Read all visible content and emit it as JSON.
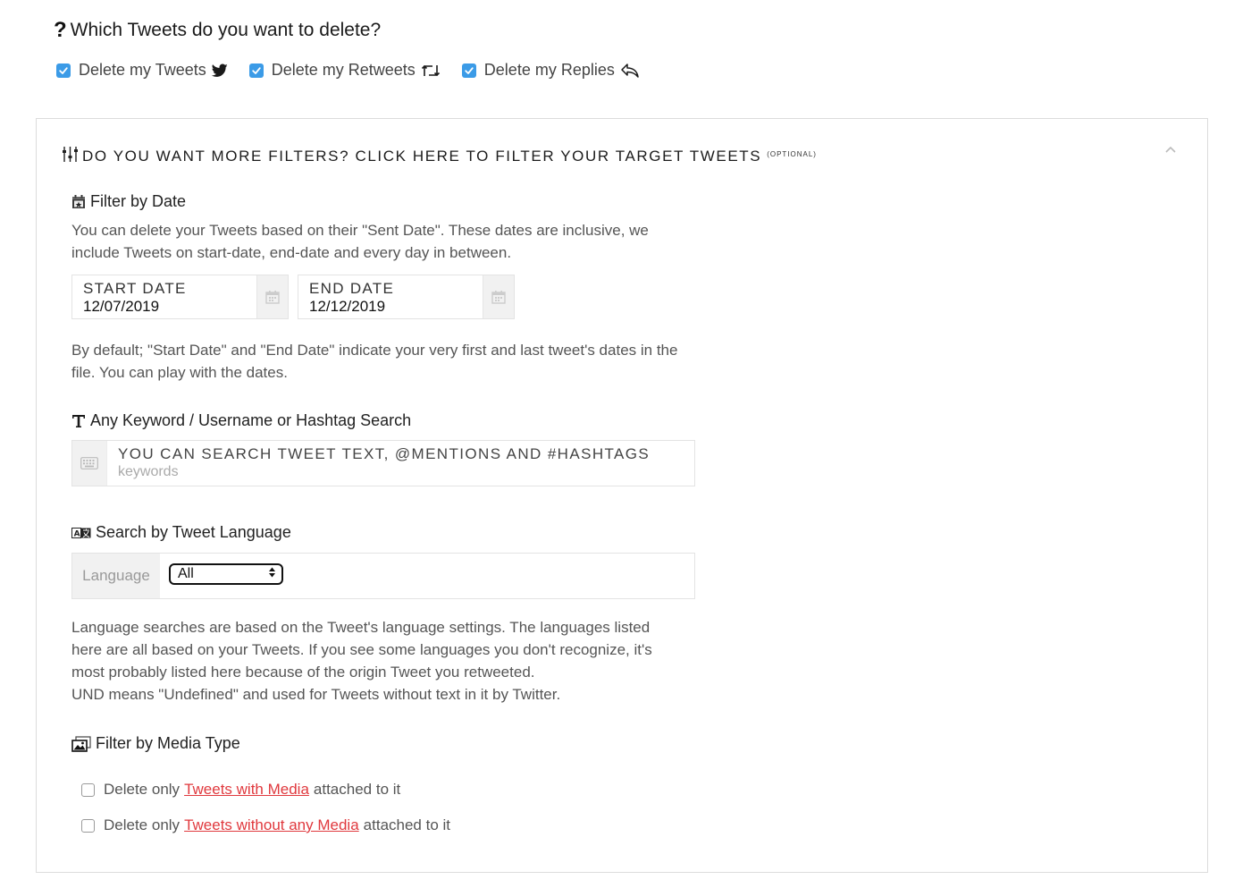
{
  "question": {
    "title": "Which Tweets do you want to delete?",
    "options": [
      {
        "label": "Delete my Tweets",
        "checked": true,
        "icon": "twitter-bird-icon"
      },
      {
        "label": "Delete my Retweets",
        "checked": true,
        "icon": "retweet-icon"
      },
      {
        "label": "Delete my Replies",
        "checked": true,
        "icon": "reply-icon"
      }
    ]
  },
  "filters": {
    "header": "DO YOU WANT MORE FILTERS? CLICK HERE TO FILTER YOUR TARGET TWEETS",
    "optional_tag": "(OPTIONAL)",
    "date": {
      "title": "Filter by Date",
      "description": "You can delete your Tweets based on their \"Sent Date\". These dates are inclusive, we include Tweets on start-date, end-date and every day in between.",
      "start_label": "START DATE",
      "start_value": "12/07/2019",
      "end_label": "END DATE",
      "end_value": "12/12/2019",
      "note": "By default; \"Start Date\" and \"End Date\" indicate your very first and last tweet's dates in the file. You can play with the dates."
    },
    "keyword": {
      "title": "Any Keyword / Username or Hashtag Search",
      "label": "YOU CAN SEARCH TWEET TEXT, @MENTIONS AND #HASHTAGS",
      "placeholder": "keywords"
    },
    "language": {
      "title": "Search by Tweet Language",
      "addon": "Language",
      "selected": "All",
      "note_lines": [
        "Language searches are based on the Tweet's language settings. The languages listed",
        "here are all based on your Tweets. If you see some languages you don't recognize, it's",
        "most probably listed here because of the origin Tweet you retweeted.",
        "UND means \"Undefined\" and used for Tweets without text in it by Twitter."
      ]
    },
    "media": {
      "title": "Filter by Media Type",
      "options": [
        {
          "prefix": "Delete only",
          "link": "Tweets with Media",
          "suffix": "attached to it",
          "checked": false
        },
        {
          "prefix": "Delete only",
          "link": "Tweets without any Media",
          "suffix": "attached to it",
          "checked": false
        }
      ]
    }
  },
  "colors": {
    "checkbox_accent": "#3b9be7",
    "link": "#e0393e"
  }
}
